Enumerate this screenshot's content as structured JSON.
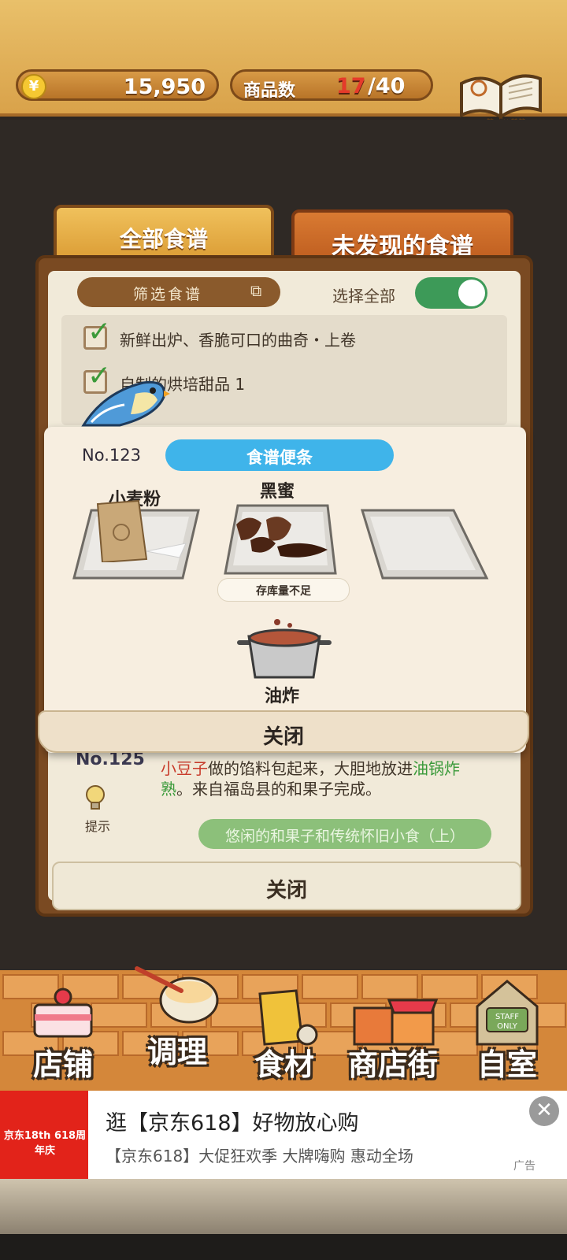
{
  "header": {
    "coins": "15,950",
    "coin_symbol": "¥",
    "goods_label": "商品数",
    "goods_count": "17",
    "goods_total": "/40",
    "recipe_book_label": "食谱"
  },
  "tabs": {
    "all_recipes": "全部食谱",
    "undiscovered": "未发现的食谱"
  },
  "filter": {
    "label": "筛选食谱",
    "select_all": "选择全部"
  },
  "recipe_list": [
    {
      "text": "新鲜出炉、香脆可口的曲奇・上卷",
      "checked": true
    },
    {
      "text": "自制的烘培甜品 1",
      "checked": true
    }
  ],
  "background_detail": {
    "number": "No.125",
    "desc_line1": [
      "小豆子",
      "做的馅料包起来，大胆地放进",
      "油锅炸"
    ],
    "desc_line2": [
      "熟",
      "。来自福岛县的和果子完成。"
    ],
    "hint_label": "提示",
    "category": "悠闲的和果子和传统怀旧小食（上）",
    "close_label": "关闭"
  },
  "modal": {
    "number": "No.123",
    "title": "食谱便条",
    "ingredients": [
      {
        "label": "小麦粉",
        "icon": "flour-bag-icon"
      },
      {
        "label": "黑蜜",
        "icon": "brown-syrup-icon",
        "status": "存库量不足"
      },
      {
        "label": "",
        "icon": "empty-tray-icon"
      }
    ],
    "method": "油炸",
    "close_label": "关闭"
  },
  "nav": [
    {
      "label": "店铺",
      "icon": "cake-icon"
    },
    {
      "label": "调理",
      "icon": "mixing-bowl-icon"
    },
    {
      "label": "食材",
      "icon": "ingredient-bag-icon"
    },
    {
      "label": "商店街",
      "icon": "shop-street-icon"
    },
    {
      "label": "自室",
      "icon": "staff-room-icon"
    }
  ],
  "ad": {
    "logo_text": "京东18th 618周年庆",
    "title": "逛【京东618】好物放心购",
    "subtitle": "【京东618】大促狂欢季 大牌嗨购 惠动全场",
    "tag": "广告"
  },
  "colors": {
    "accent_blue": "#3fb4ea",
    "toggle_green": "#3d9a58",
    "warning_red": "#e53a2a",
    "ad_red": "#e2231a"
  }
}
